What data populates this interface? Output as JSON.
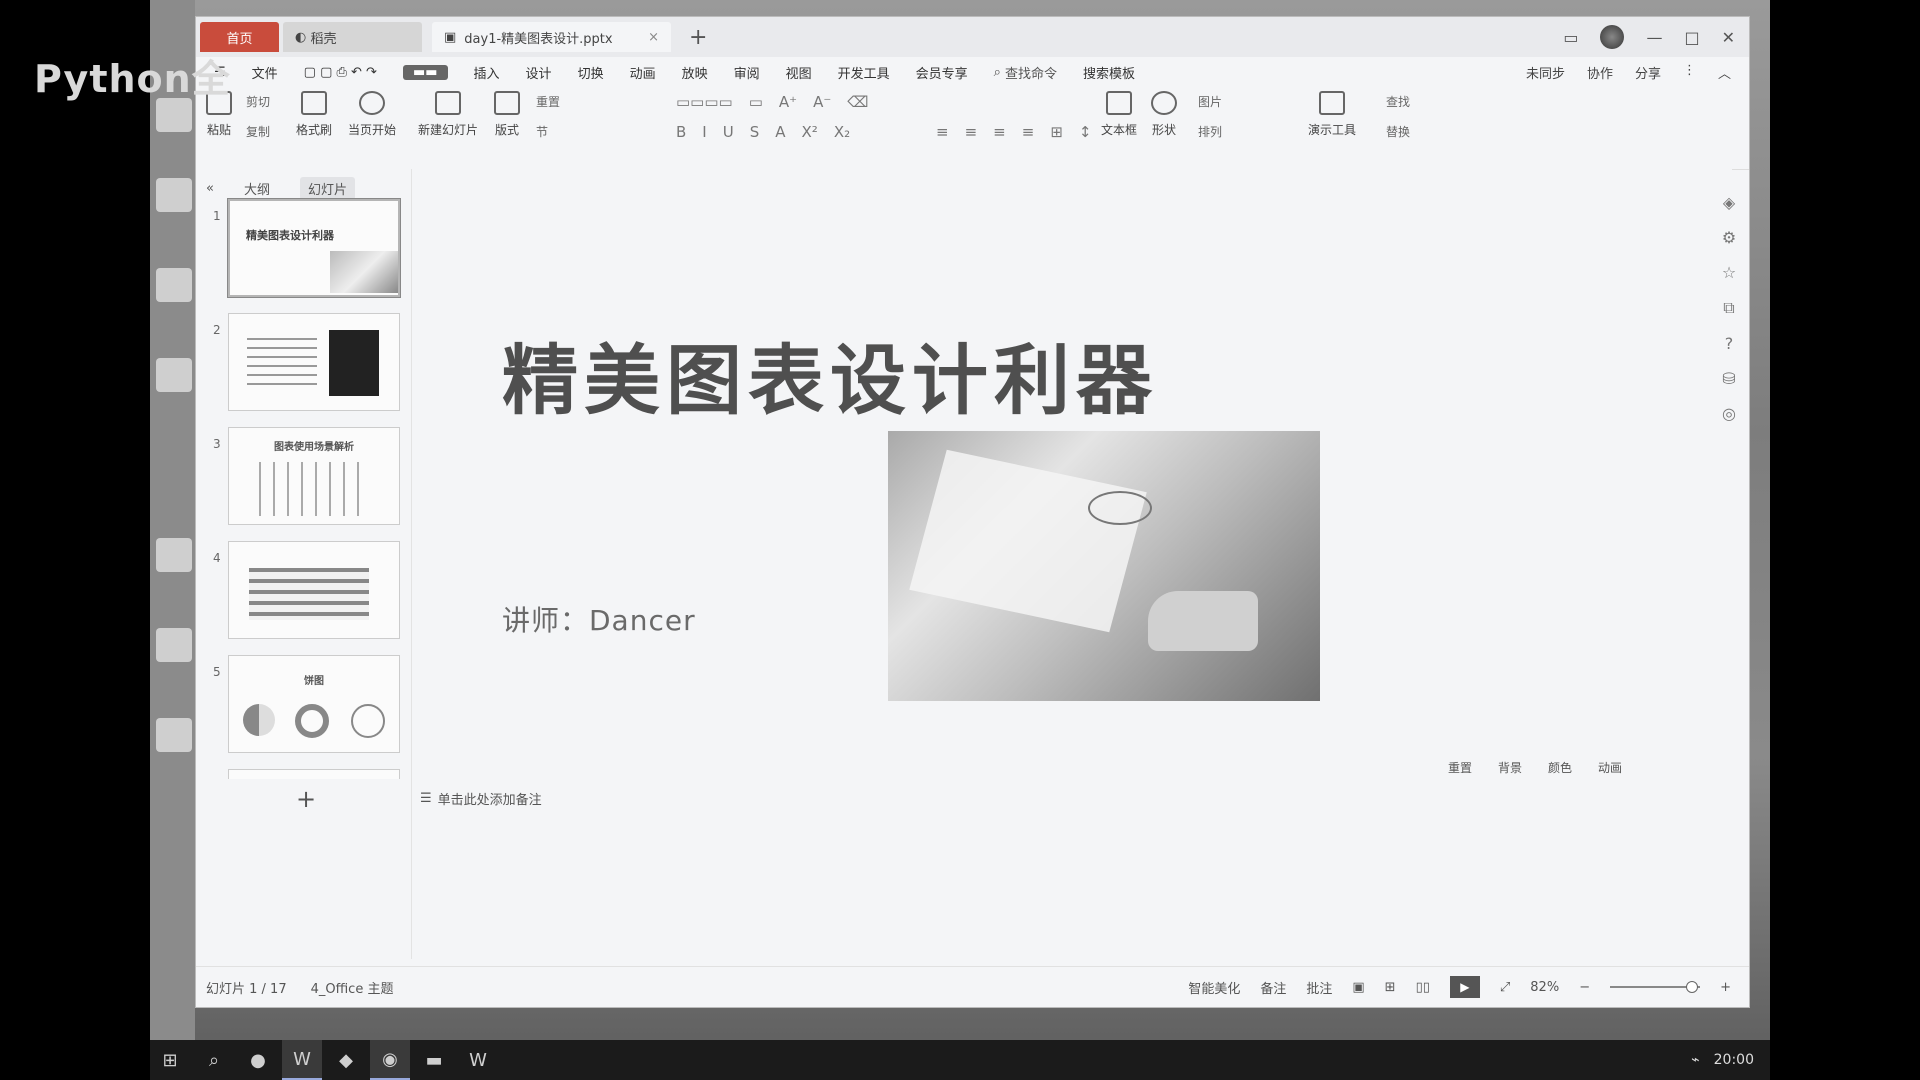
{
  "watermark": "Python全",
  "window": {
    "tabs": [
      {
        "label": "首页"
      },
      {
        "label": "稻壳"
      },
      {
        "label": "day1-精美图表设计.pptx"
      }
    ]
  },
  "menubar": {
    "file": "文件",
    "items": [
      "插入",
      "设计",
      "切换",
      "动画",
      "放映",
      "审阅",
      "视图",
      "开发工具",
      "会员专享"
    ],
    "search_command": "查找命令",
    "search_template": "搜索模板",
    "right": [
      "未同步",
      "协作",
      "分享"
    ]
  },
  "ribbon": {
    "paste": "粘贴",
    "cut": "剪切",
    "copy": "复制",
    "format_painter": "格式刷",
    "from_current": "当页开始",
    "new_slide": "新建幻灯片",
    "layout": "版式",
    "section": "节",
    "reset": "重置",
    "textbox": "文本框",
    "shape": "形状",
    "picture": "图片",
    "arrange": "排列",
    "present_tools": "演示工具",
    "find": "查找",
    "replace": "替换"
  },
  "left_panel": {
    "outline_tab": "大纲",
    "slides_tab": "幻灯片",
    "thumbnails": [
      {
        "num": "1",
        "title": "精美图表设计利器"
      },
      {
        "num": "2",
        "title": ""
      },
      {
        "num": "3",
        "title": "图表使用场景解析"
      },
      {
        "num": "4",
        "title": ""
      },
      {
        "num": "5",
        "title": "饼图"
      }
    ],
    "add_slide": "+"
  },
  "slide": {
    "title": "精美图表设计利器",
    "subtitle": "讲师：Dancer"
  },
  "canvas": {
    "notes_hint": "单击此处添加备注",
    "float_tools": [
      "重置",
      "背景",
      "颜色",
      "动画"
    ]
  },
  "statusbar": {
    "slide_counter": "幻灯片 1 / 17",
    "theme": "4_Office 主题",
    "smart_beautify": "智能美化",
    "notes": "备注",
    "comments": "批注",
    "zoom": "82%"
  },
  "taskbar": {
    "time": "20:00"
  }
}
